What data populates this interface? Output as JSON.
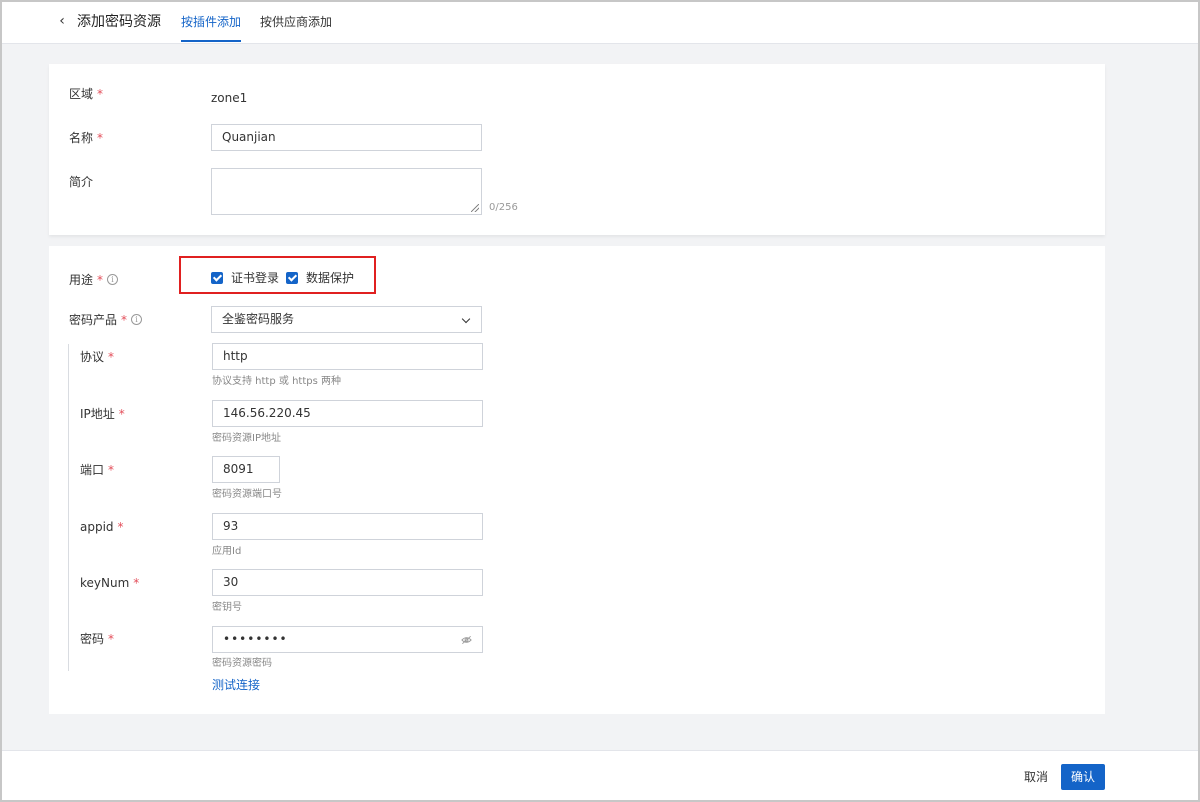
{
  "header": {
    "back_icon": "chevron-left-icon",
    "title": "添加密码资源",
    "tabs": [
      {
        "label": "按插件添加",
        "active": true
      },
      {
        "label": "按供应商添加",
        "active": false
      }
    ]
  },
  "basic": {
    "zone": {
      "label": "区域",
      "required": "*",
      "value": "zone1"
    },
    "name": {
      "label": "名称",
      "required": "*",
      "value": "Quanjian"
    },
    "intro": {
      "label": "简介",
      "value": "",
      "counter": "0/256"
    }
  },
  "usage": {
    "label": "用途",
    "required": "*",
    "options": [
      {
        "label": "证书登录",
        "checked": true
      },
      {
        "label": "数据保护",
        "checked": true
      }
    ]
  },
  "product": {
    "label": "密码产品",
    "required": "*",
    "value": "全鉴密码服务"
  },
  "fields": {
    "protocol": {
      "label": "协议",
      "required": "*",
      "value": "http",
      "help": "协议支持 http 或 https 两种"
    },
    "ip": {
      "label": "IP地址",
      "required": "*",
      "value": "146.56.220.45",
      "help": "密码资源IP地址"
    },
    "port": {
      "label": "端口",
      "required": "*",
      "value": "8091",
      "help": "密码资源端口号"
    },
    "appid": {
      "label": "appid",
      "required": "*",
      "value": "93",
      "help": "应用Id"
    },
    "keynum": {
      "label": "keyNum",
      "required": "*",
      "value": "30",
      "help": "密钥号"
    },
    "password": {
      "label": "密码",
      "required": "*",
      "value": "••••••••",
      "help": "密码资源密码"
    }
  },
  "test_link": "测试连接",
  "footer": {
    "cancel": "取消",
    "confirm": "确认"
  },
  "colors": {
    "accent": "#1464c8",
    "required": "#e34d59",
    "highlight": "#e02020"
  }
}
